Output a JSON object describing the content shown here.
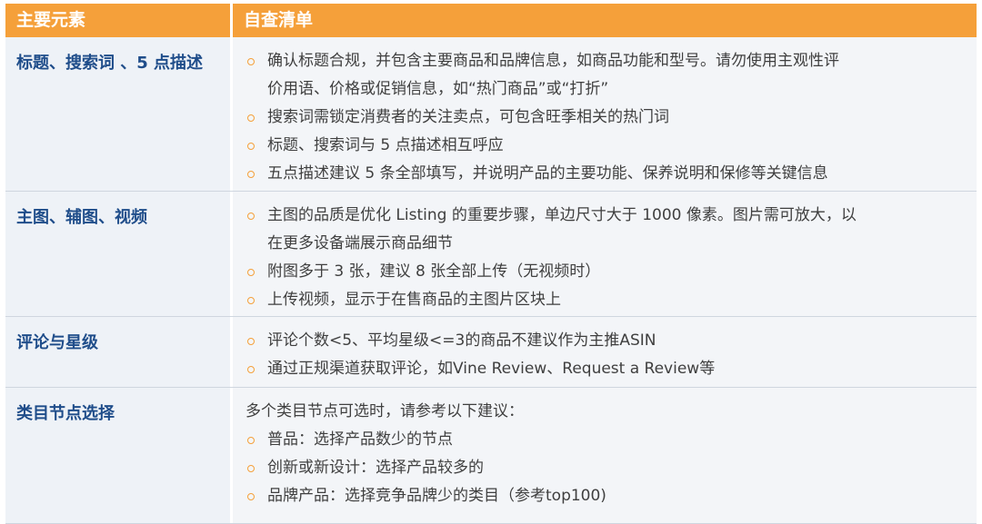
{
  "header": {
    "col1": "主要元素",
    "col2": "自查清单"
  },
  "rows": [
    {
      "element": "标题、搜索词 、5 点描述",
      "lines": [
        {
          "text": "确认标题合规，并包含主要商品和品牌信息，如商品功能和型号。请勿使用主观性评",
          "type": "bullet"
        },
        {
          "text": "价用语、价格或促销信息，如“热门商品”或“打折”",
          "type": "cont"
        },
        {
          "text": "搜索词需锁定消费者的关注卖点，可包含旺季相关的热门词",
          "type": "bullet"
        },
        {
          "text": "标题、搜索词与 5 点描述相互呼应",
          "type": "bullet"
        },
        {
          "text": "五点描述建议 5 条全部填写，并说明产品的主要功能、保养说明和保修等关键信息",
          "type": "bullet"
        }
      ]
    },
    {
      "element": "主图、辅图、视频",
      "lines": [
        {
          "text": "主图的品质是优化 Listing 的重要步骤，单边尺寸大于 1000 像素。图片需可放大，以",
          "type": "bullet"
        },
        {
          "text": "在更多设备端展示商品细节",
          "type": "cont"
        },
        {
          "text": "附图多于 3 张，建议 8 张全部上传（无视频时）",
          "type": "bullet"
        },
        {
          "text": "上传视频，显示于在售商品的主图片区块上",
          "type": "bullet"
        }
      ]
    },
    {
      "element": "评论与星级",
      "lines": [
        {
          "text": "评论个数<5、平均星级<=3的商品不建议作为主推ASIN",
          "type": "bullet"
        },
        {
          "text": "通过正规渠道获取评论，如Vine Review、Request a Review等",
          "type": "bullet"
        }
      ]
    },
    {
      "element": "类目节点选择",
      "lines": [
        {
          "text": "多个类目节点可选时，请参考以下建议：",
          "type": "plain"
        },
        {
          "text": "普品：选择产品数少的节点",
          "type": "bullet"
        },
        {
          "text": "创新或新设计：选择产品较多的",
          "type": "bullet"
        },
        {
          "text": "品牌产品：选择竞争品牌少的类目（参考top100)",
          "type": "bullet"
        }
      ]
    }
  ]
}
